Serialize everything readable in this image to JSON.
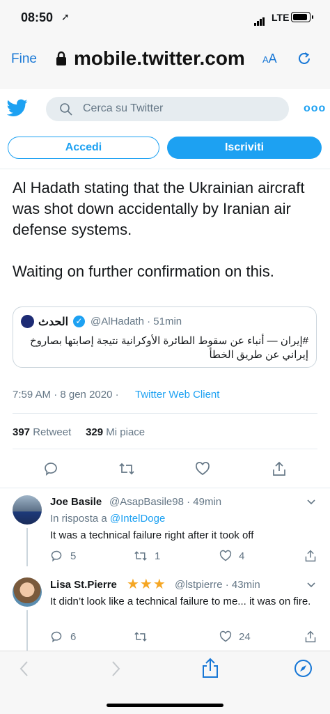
{
  "status": {
    "time": "08:50",
    "carrier": "LTE"
  },
  "browser": {
    "done": "Fine",
    "url": "mobile.twitter.com",
    "text_size": "AA"
  },
  "twitter": {
    "search_placeholder": "Cerca su Twitter",
    "login_label": "Accedi",
    "signup_label": "Iscriviti"
  },
  "tweet": {
    "text": "Al Hadath stating that the Ukrainian aircraft was shot down accidentally by Iranian air defense systems.\n\nWaiting on further confirmation on this.",
    "quote": {
      "name": "الحدث",
      "handle": "@AlHadath",
      "time": "51min",
      "text": "#إيران — أنباء عن سقوط الطائرة الأوكرانية نتيجة إصابتها بصاروخ إيراني عن طريق الخطأ"
    },
    "timestamp": "7:59 AM · 8 gen 2020 ·",
    "client": "Twitter Web Client",
    "retweets": "397",
    "retweets_label": "Retweet",
    "likes": "329",
    "likes_label": "Mi piace"
  },
  "replies": [
    {
      "name": "Joe Basile",
      "handle": "@AsapBasile98 · 49min",
      "reply_to_label": "In risposta a",
      "reply_to": "@IntelDoge",
      "text": "It was a technical failure right after it took off",
      "comments": "5",
      "retweets": "1",
      "likes": "4"
    },
    {
      "name": "Lisa St.Pierre",
      "stars": "★★★",
      "handle": "@lstpierre · 43min",
      "text": "It didn’t look like a technical failure to me... it was on fire.",
      "comments": "6",
      "retweets": "",
      "likes": "24"
    }
  ],
  "colors": {
    "accent": "#1da1f2",
    "ios_blue": "#1777d6",
    "muted": "#657786"
  }
}
